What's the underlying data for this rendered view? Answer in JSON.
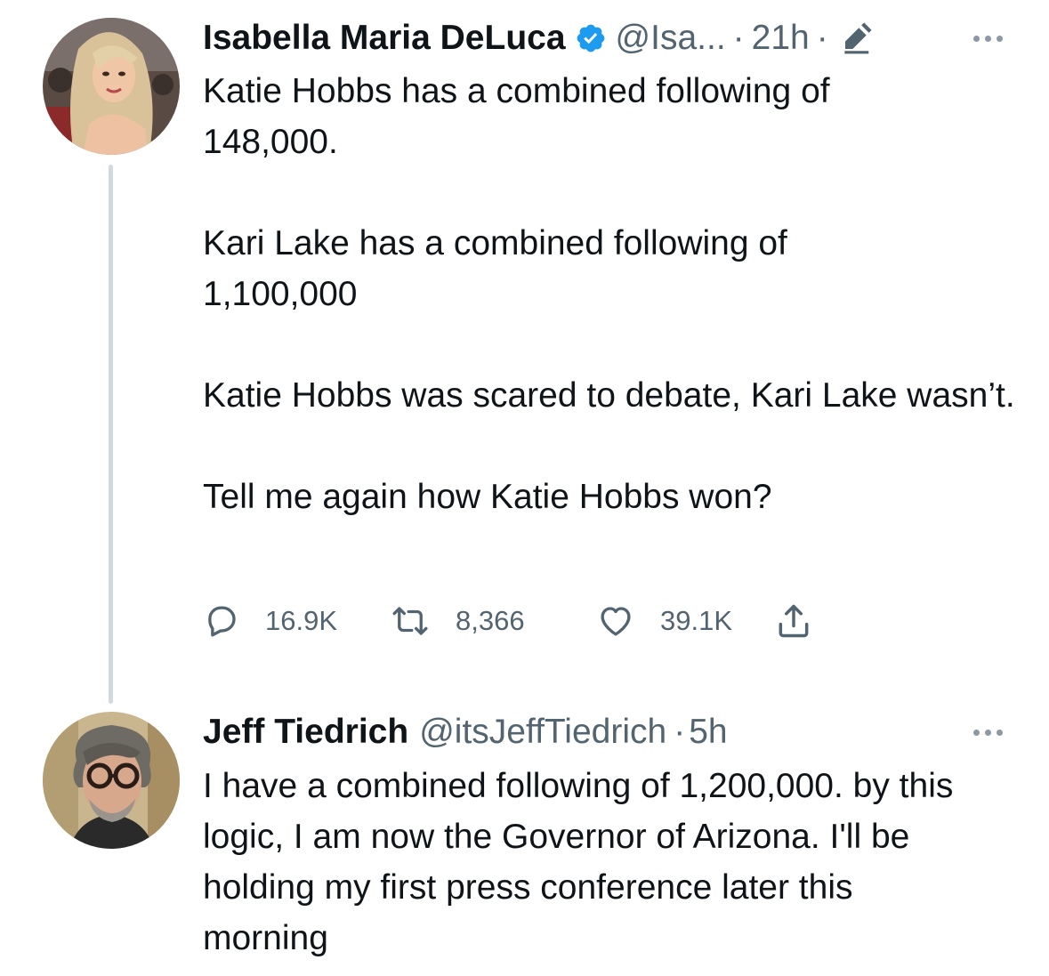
{
  "tweets": [
    {
      "author": {
        "display_name": "Isabella Maria DeLuca",
        "verified": true,
        "handle": "@Isa...",
        "separator": "·",
        "time": "21h",
        "separator2": "·",
        "avatar_icon": "woman-portrait-avatar"
      },
      "text": {
        "p1": "Katie Hobbs has a combined following of 148,000.",
        "p2": "Kari Lake has a combined following of 1,100,000",
        "p3": "Katie Hobbs was scared to debate, Kari Lake wasn’t.",
        "p4": "Tell me again how Katie Hobbs won?"
      },
      "actions": {
        "replies": "16.9K",
        "retweets": "8,366",
        "likes": "39.1K",
        "reply_icon": "speech-bubble-icon",
        "retweet_icon": "retweet-arrows-icon",
        "like_icon": "heart-icon",
        "share_icon": "share-upload-icon"
      },
      "edited_icon": "pencil-edit-icon",
      "more_icon": "more-dots-icon"
    },
    {
      "author": {
        "display_name": "Jeff Tiedrich",
        "verified": false,
        "handle": "@itsJeffTiedrich",
        "separator": "·",
        "time": "5h",
        "avatar_icon": "man-with-glasses-avatar"
      },
      "text": {
        "p1": "I have a combined following of 1,200,000. by this logic, I am now the Governor of Arizona. I'll be holding my first press conference later this morning"
      },
      "more_icon": "more-dots-icon"
    }
  ],
  "colors": {
    "text_primary": "#0f1419",
    "text_secondary": "#536471",
    "verified_blue": "#1d9bf0",
    "thread_line": "#cfd9de"
  }
}
